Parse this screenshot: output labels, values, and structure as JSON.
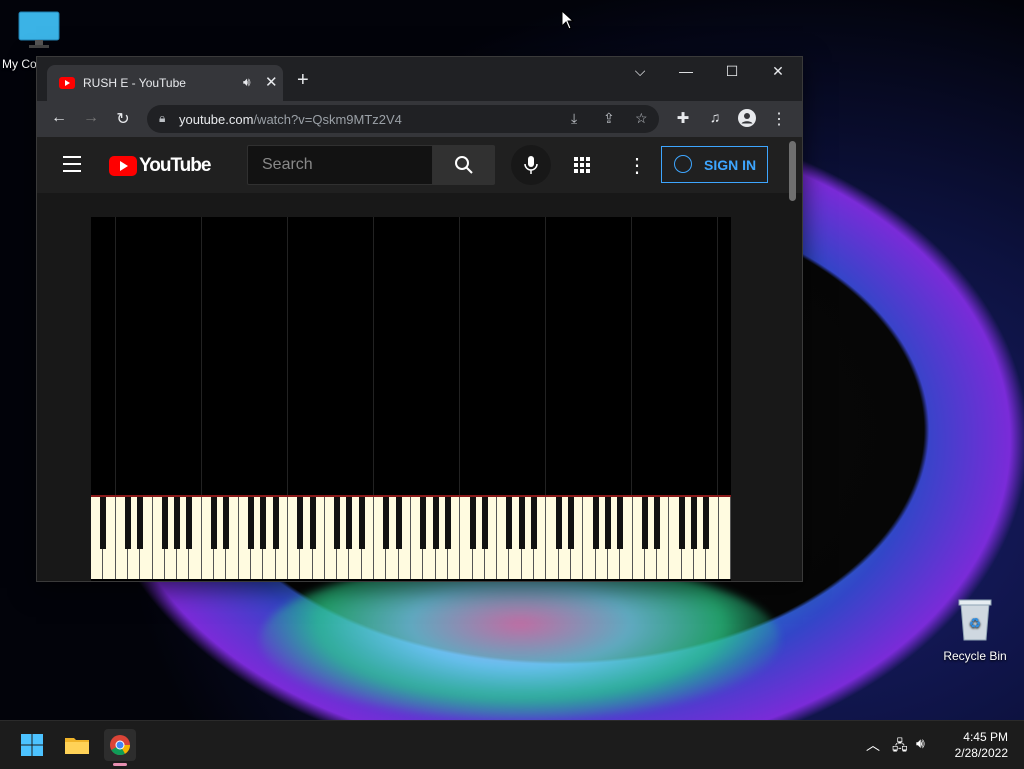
{
  "desktop": {
    "icons": [
      {
        "label": "My Co",
        "icon": "monitor-icon"
      },
      {
        "label": "Recycle Bin",
        "icon": "recycle-bin-icon"
      }
    ]
  },
  "browser": {
    "tab": {
      "title": "RUSH E - YouTube",
      "audio_icon": "speaker-icon",
      "close": "✕"
    },
    "new_tab": "+",
    "window_controls": {
      "dropdown": "⌵",
      "minimize": "—",
      "maximize": "☐",
      "close": "✕"
    },
    "address": {
      "domain": "youtube.com",
      "path": "/watch?v=Qskm9MTz2V4"
    }
  },
  "youtube": {
    "logo_text": "YouTube",
    "search_placeholder": "Search",
    "sign_in": "SIGN IN"
  },
  "taskbar": {
    "time": "4:45 PM",
    "date": "2/28/2022",
    "apps": [
      "start-icon",
      "file-explorer-icon",
      "chrome-icon"
    ],
    "tray": [
      "chevron-up-icon",
      "network-icon",
      "volume-icon"
    ]
  }
}
